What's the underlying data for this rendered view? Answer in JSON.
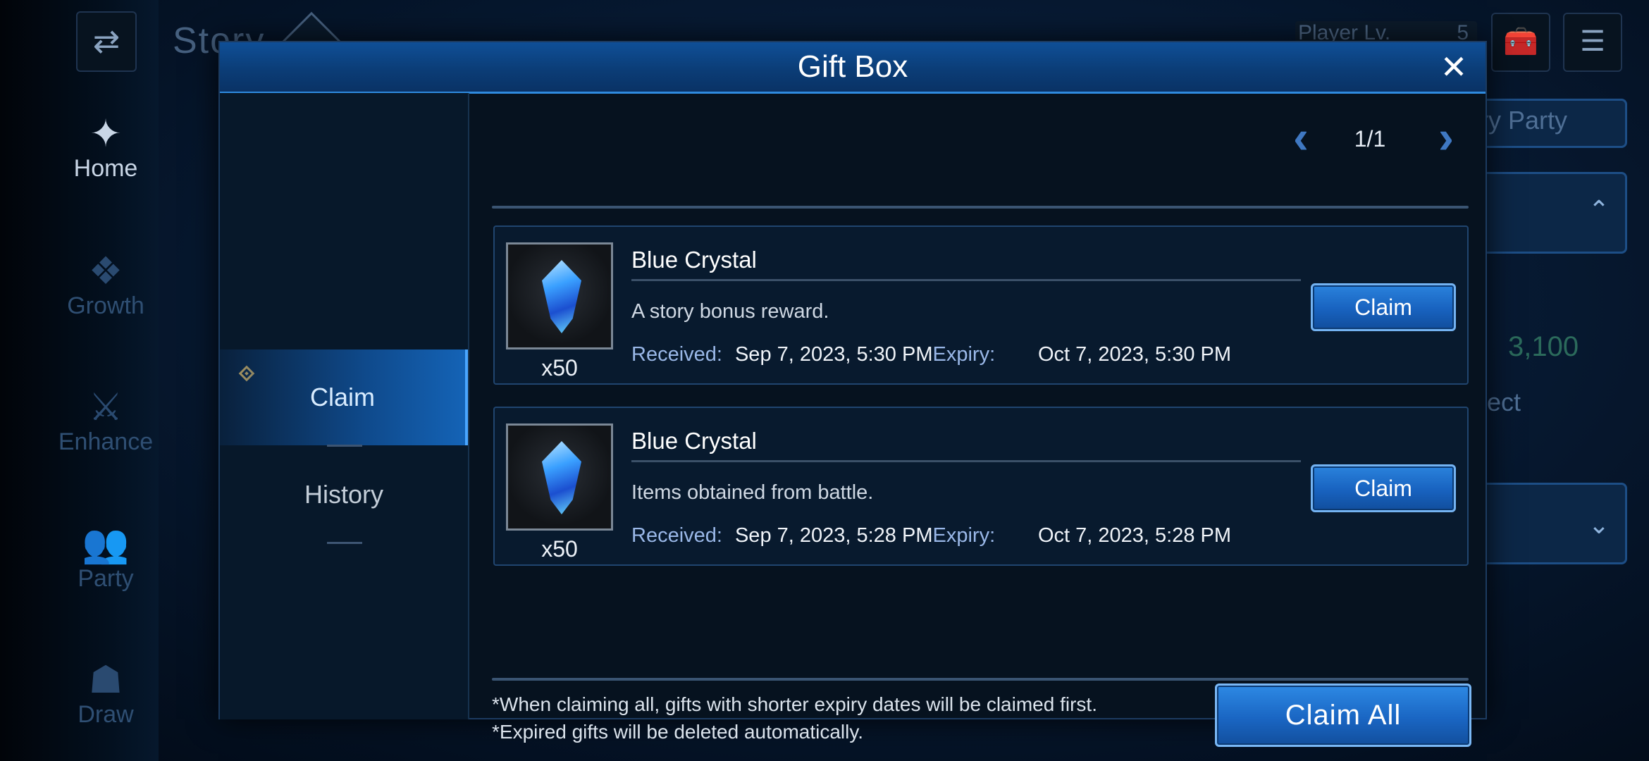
{
  "background": {
    "screen_title": "Story",
    "nav": [
      {
        "label": "Home",
        "icon": "home-icon",
        "glyph": "✦"
      },
      {
        "label": "Growth",
        "icon": "growth-icon",
        "glyph": "❖"
      },
      {
        "label": "Enhance",
        "icon": "enhance-icon",
        "glyph": "⚔"
      },
      {
        "label": "Party",
        "icon": "party-icon",
        "glyph": "👥"
      },
      {
        "label": "Draw",
        "icon": "draw-icon",
        "glyph": "☗"
      }
    ],
    "player_level_label": "Player Lv.",
    "player_level_value": "5",
    "party_button_label": "ry Party",
    "currency_value": "3,100",
    "select_button_label": "ect"
  },
  "gift_box": {
    "title": "Gift Box",
    "close_glyph": "✕",
    "tabs": [
      {
        "label": "Claim",
        "active": true
      },
      {
        "label": "History",
        "active": false
      }
    ],
    "pager": {
      "prev": "‹",
      "text": "1/1",
      "next": "›"
    },
    "items": [
      {
        "name": "Blue Crystal",
        "quantity": "x50",
        "description": "A story bonus reward.",
        "received_label": "Received:",
        "received_value": "Sep 7, 2023, 5:30 PM",
        "expiry_label": "Expiry:",
        "expiry_value": "Oct 7, 2023, 5:30 PM",
        "claim_label": "Claim",
        "icon": "blue-crystal-icon"
      },
      {
        "name": "Blue Crystal",
        "quantity": "x50",
        "description": "Items obtained from battle.",
        "received_label": "Received:",
        "received_value": "Sep 7, 2023, 5:28 PM",
        "expiry_label": "Expiry:",
        "expiry_value": "Oct 7, 2023, 5:28 PM",
        "claim_label": "Claim",
        "icon": "blue-crystal-icon"
      }
    ],
    "notes": [
      "*When claiming all, gifts with shorter expiry dates will be claimed first.",
      "*Expired gifts will be deleted automatically."
    ],
    "claim_all_label": "Claim All"
  },
  "colors": {
    "accent": "#1862bf",
    "header": "#0b3d77",
    "label_blue": "#9ab8e8",
    "marker_gold": "#d2a64a"
  }
}
